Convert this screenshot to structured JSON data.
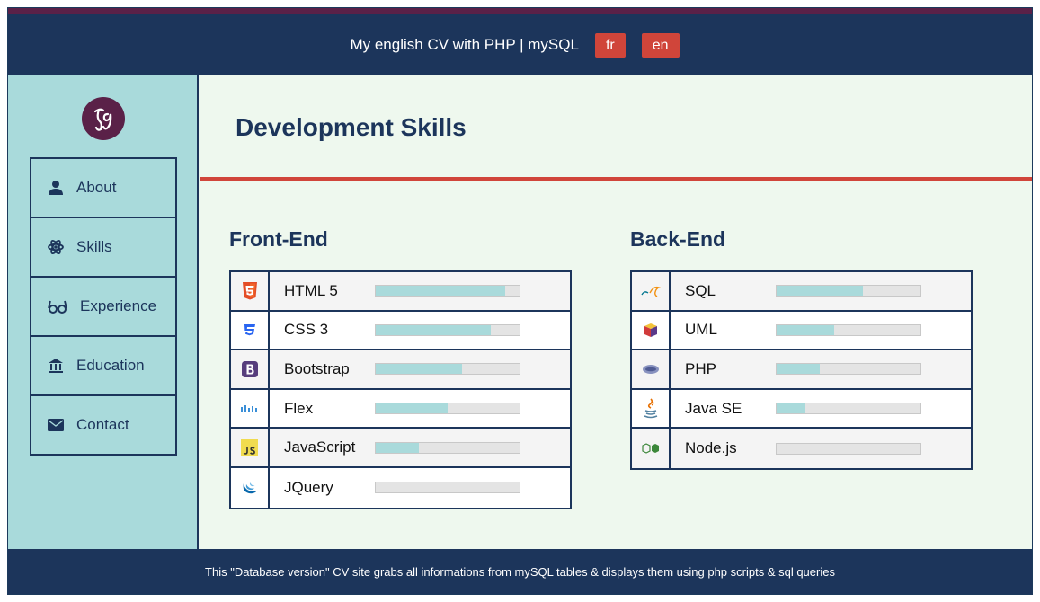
{
  "header": {
    "title": "My english CV with PHP | mySQL",
    "languages": [
      "fr",
      "en"
    ]
  },
  "sidebar": {
    "logo_icon": "jg-monogram-logo",
    "items": [
      {
        "label": "About",
        "icon": "user-icon"
      },
      {
        "label": "Skills",
        "icon": "atom-icon"
      },
      {
        "label": "Experience",
        "icon": "glasses-icon"
      },
      {
        "label": "Education",
        "icon": "institution-icon"
      },
      {
        "label": "Contact",
        "icon": "envelope-icon"
      }
    ]
  },
  "main": {
    "title": "Development Skills",
    "frontend": {
      "title": "Front-End",
      "skills": [
        {
          "name": "HTML 5",
          "icon": "html5-icon",
          "level": 0.9
        },
        {
          "name": "CSS 3",
          "icon": "css3-icon",
          "level": 0.8
        },
        {
          "name": "Bootstrap",
          "icon": "bootstrap-icon",
          "level": 0.6
        },
        {
          "name": "Flex",
          "icon": "flex-icon",
          "level": 0.5
        },
        {
          "name": "JavaScript",
          "icon": "javascript-icon",
          "level": 0.3
        },
        {
          "name": "JQuery",
          "icon": "jquery-icon",
          "level": 0.0
        }
      ]
    },
    "backend": {
      "title": "Back-End",
      "skills": [
        {
          "name": "SQL",
          "icon": "mysql-icon",
          "level": 0.6
        },
        {
          "name": "UML",
          "icon": "uml-icon",
          "level": 0.4
        },
        {
          "name": "PHP",
          "icon": "php-icon",
          "level": 0.3
        },
        {
          "name": "Java SE",
          "icon": "java-icon",
          "level": 0.2
        },
        {
          "name": "Node.js",
          "icon": "nodejs-icon",
          "level": 0.0
        }
      ]
    }
  },
  "footer": {
    "text": "This \"Database version\" CV site grabs all informations from mySQL tables & displays them using php scripts & sql queries"
  },
  "colors": {
    "navy": "#1c355b",
    "accent_red": "#d0453a",
    "plum": "#5a2148",
    "teal": "#a9dadb",
    "page_bg": "#eef8ee"
  }
}
